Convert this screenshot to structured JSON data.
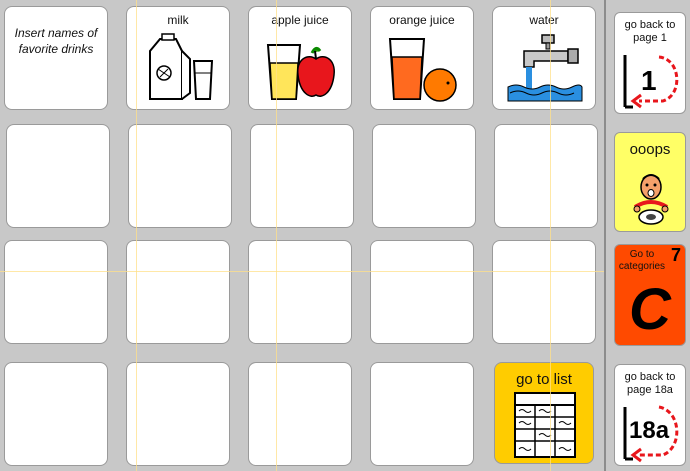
{
  "grid": {
    "note_text": "Insert names of favorite drinks",
    "drinks": [
      {
        "label": "milk",
        "icon": "milk-carton-icon"
      },
      {
        "label": "apple juice",
        "icon": "apple-juice-icon"
      },
      {
        "label": "orange juice",
        "icon": "orange-juice-icon"
      },
      {
        "label": "water",
        "icon": "water-faucet-icon"
      }
    ],
    "go_to_list": {
      "label": "go to list",
      "icon": "list-table-icon",
      "color": "#ffcc00"
    }
  },
  "sidebar": {
    "page1": {
      "label": "go back to page 1",
      "number": "1",
      "icon": "return-arrow-icon"
    },
    "oops": {
      "label": "ooops",
      "icon": "oops-face-icon",
      "color": "#ffff66"
    },
    "categories": {
      "label": "Go to categories",
      "number": "7",
      "letter": "C",
      "color": "#ff4a00"
    },
    "page18a": {
      "label": "go back to page 18a",
      "number": "18a",
      "icon": "return-arrow-icon"
    }
  }
}
